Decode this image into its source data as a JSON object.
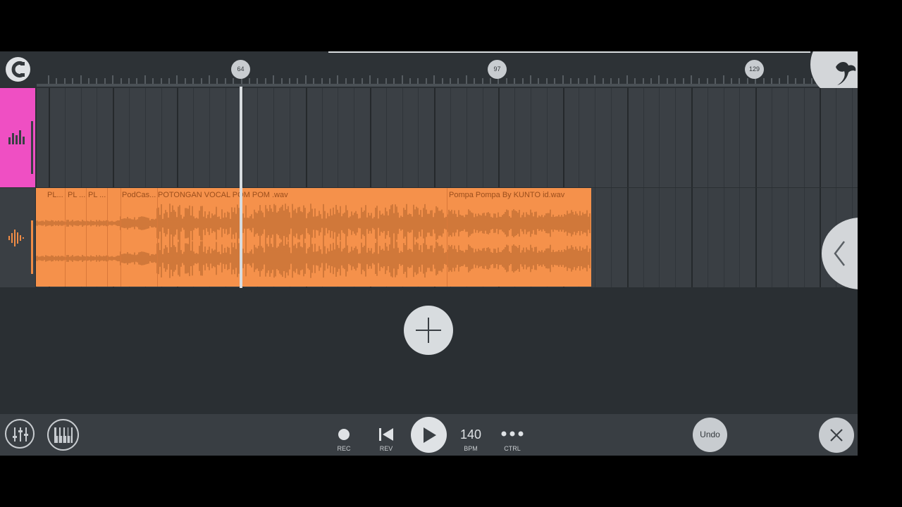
{
  "ruler": {
    "markers": [
      "64",
      "97",
      "129"
    ]
  },
  "tracks": [
    {
      "name": "",
      "color": "#ef4fc3",
      "icon": "bars-chart-icon"
    },
    {
      "name": "",
      "color": "#3a3f44",
      "icon": "audio-wave-icon"
    }
  ],
  "clip": {
    "color": "#f5914b",
    "labels": {
      "a": "PL...",
      "b": "PL ...",
      "c": "PL ...",
      "d": "PodCas...",
      "e": "POTONGAN VOCAL POM POM .wav",
      "f": "Pompa Pompa By KUNTO id.wav"
    }
  },
  "transport": {
    "rec_label": "REC",
    "rev_label": "REV",
    "bpm_value": "140",
    "bpm_label": "BPM",
    "ctrl_label": "CTRL",
    "undo_label": "Undo"
  },
  "icons": {
    "snap": "magnet-icon",
    "logo": "fruit-logo-icon",
    "side": "chevron-left-icon",
    "add": "plus-icon",
    "mixer": "mixer-icon",
    "piano": "piano-icon",
    "close": "close-icon"
  }
}
